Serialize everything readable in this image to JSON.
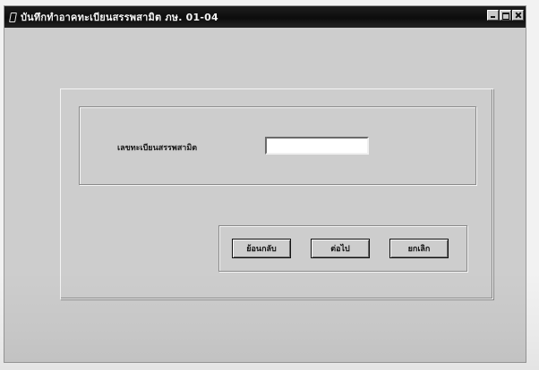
{
  "window": {
    "title": "บันทึกทำอาคทะเบียนสรรพสามิต ภษ. 01-04"
  },
  "form": {
    "field_label": "เลขทะเบียนสรรพสามิต",
    "field_value": "",
    "field_placeholder": ""
  },
  "buttons": {
    "back": "ย้อนกลับ",
    "next": "ต่อไป",
    "cancel": "ยกเลิก"
  },
  "icons": {
    "app": "application-icon",
    "minimize": "minimize-icon",
    "maximize": "maximize-icon",
    "close": "close-icon"
  },
  "colors": {
    "titlebar": "#111111",
    "window_face": "#cdcdcd",
    "field_bg": "#ffffff"
  }
}
